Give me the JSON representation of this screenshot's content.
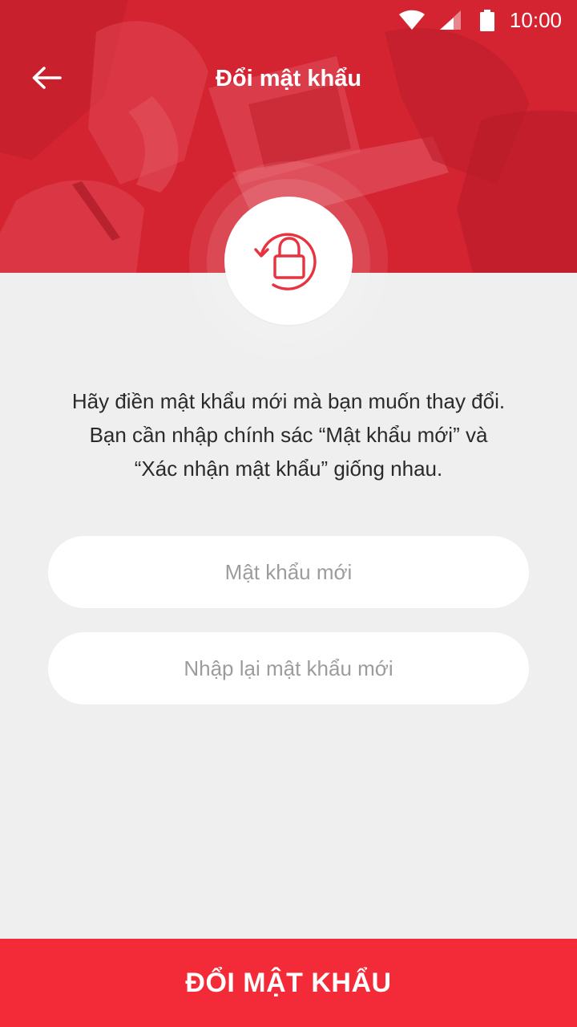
{
  "status_bar": {
    "time": "10:00",
    "icons": [
      "wifi-icon",
      "signal-icon",
      "battery-icon"
    ]
  },
  "header": {
    "back_icon": "arrow-left-icon",
    "title": "Đổi mật khẩu",
    "hero_icon": "lock-reset-icon"
  },
  "description": {
    "lines": [
      "Hãy điền mật khẩu mới mà bạn muốn thay đổi.",
      "Bạn cần nhập chính sác “Mật khẩu mới” và",
      "“Xác nhận mật khẩu” giống nhau."
    ]
  },
  "form": {
    "new_password": {
      "placeholder": "Mật khẩu mới",
      "value": ""
    },
    "confirm_password": {
      "placeholder": "Nhập lại mật khẩu mới",
      "value": ""
    }
  },
  "submit": {
    "label": "ĐỔI MẬT KHẨU"
  },
  "colors": {
    "accent": "#f32a37",
    "header_tint": "#d32432",
    "background": "#efefef",
    "text": "#2a2a2a",
    "placeholder": "#9c9c9c"
  }
}
